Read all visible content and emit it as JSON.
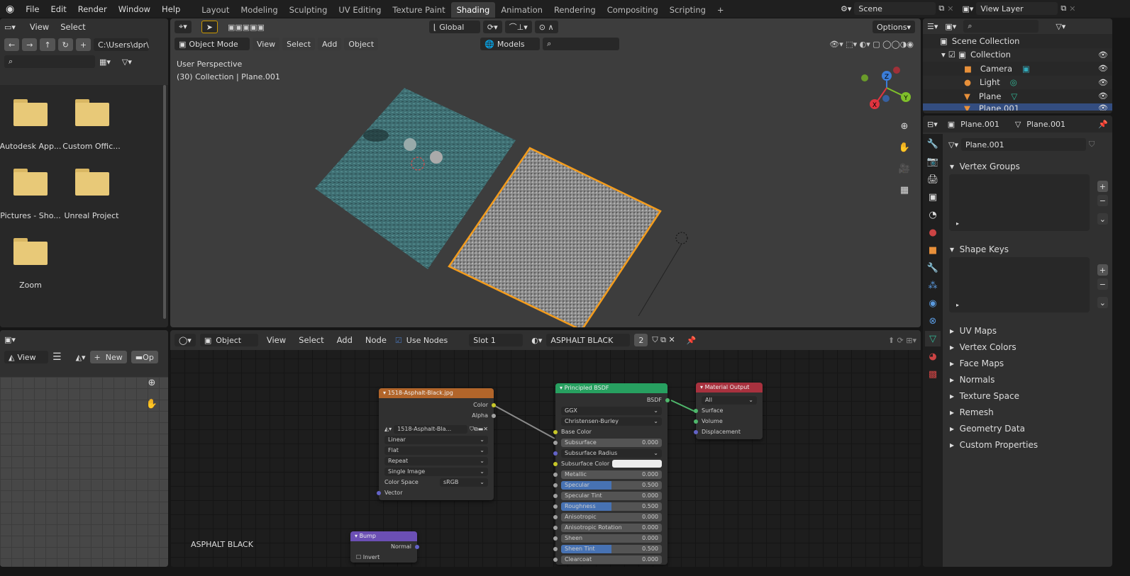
{
  "topbar": {
    "menus": [
      "File",
      "Edit",
      "Render",
      "Window",
      "Help"
    ],
    "tabs": [
      "Layout",
      "Modeling",
      "Sculpting",
      "UV Editing",
      "Texture Paint",
      "Shading",
      "Animation",
      "Rendering",
      "Compositing",
      "Scripting"
    ],
    "active_tab": "Shading",
    "scene": "Scene",
    "view_layer": "View Layer"
  },
  "file_browser": {
    "menus": [
      "View",
      "Select"
    ],
    "path": "C:\\Users\\dpr\\...",
    "items": [
      "Autodesk App...",
      "Custom Offic...",
      "Pictures - Sho...",
      "Unreal Project",
      "Zoom"
    ]
  },
  "viewport": {
    "mode": "Object Mode",
    "menus": [
      "View",
      "Select",
      "Add",
      "Object"
    ],
    "orientation": "Global",
    "models": "Models",
    "options": "Options",
    "perspective": "User Perspective",
    "info": "(30) Collection | Plane.001",
    "axes": [
      "X",
      "Y",
      "Z"
    ]
  },
  "outliner": {
    "root": "Scene Collection",
    "collection": "Collection",
    "items": [
      "Camera",
      "Light",
      "Plane",
      "Plane.001"
    ]
  },
  "properties": {
    "object": "Plane.001",
    "data": "Plane.001",
    "mesh_name": "Plane.001",
    "sections": [
      "Vertex Groups",
      "Shape Keys",
      "UV Maps",
      "Vertex Colors",
      "Face Maps",
      "Normals",
      "Texture Space",
      "Remesh",
      "Geometry Data",
      "Custom Properties"
    ]
  },
  "image_editor": {
    "view": "View",
    "new": "New",
    "open": "Op"
  },
  "node_editor": {
    "object": "Object",
    "menus": [
      "View",
      "Select",
      "Add",
      "Node"
    ],
    "use_nodes": "Use Nodes",
    "slot": "Slot 1",
    "material": "ASPHALT BLACK",
    "users": "2",
    "frame_label": "ASPHALT BLACK",
    "image_node": {
      "title": "1518-Asphalt-Black.jpg",
      "outputs": [
        "Color",
        "Alpha"
      ],
      "image": "1518-Asphalt-Bla...",
      "interpolation": "Linear",
      "projection": "Flat",
      "extension": "Repeat",
      "source": "Single Image",
      "color_space_label": "Color Space",
      "color_space": "sRGB",
      "input": "Vector"
    },
    "bsdf": {
      "title": "Principled BSDF",
      "output": "BSDF",
      "distribution": "GGX",
      "subsurface_method": "Christensen-Burley",
      "base_color": "Base Color",
      "fields": [
        {
          "label": "Subsurface",
          "value": "0.000",
          "fill": 0
        },
        {
          "label": "Subsurface Radius",
          "value": "",
          "fill": 0
        },
        {
          "label": "Subsurface Color",
          "value": "",
          "fill": 0
        },
        {
          "label": "Metallic",
          "value": "0.000",
          "fill": 0
        },
        {
          "label": "Specular",
          "value": "0.500",
          "fill": 0.5
        },
        {
          "label": "Specular Tint",
          "value": "0.000",
          "fill": 0
        },
        {
          "label": "Roughness",
          "value": "0.500",
          "fill": 0.5
        },
        {
          "label": "Anisotropic",
          "value": "0.000",
          "fill": 0
        },
        {
          "label": "Anisotropic Rotation",
          "value": "0.000",
          "fill": 0
        },
        {
          "label": "Sheen",
          "value": "0.000",
          "fill": 0
        },
        {
          "label": "Sheen Tint",
          "value": "0.500",
          "fill": 0.5
        },
        {
          "label": "Clearcoat",
          "value": "0.000",
          "fill": 0
        }
      ]
    },
    "output": {
      "title": "Material Output",
      "target": "All",
      "inputs": [
        "Surface",
        "Volume",
        "Displacement"
      ]
    },
    "bump": {
      "title": "Bump",
      "output": "Normal",
      "invert": "Invert"
    }
  },
  "colors": {
    "accent": "#4772b3",
    "image_node": "#b2652a",
    "shader_node": "#27a060",
    "output_node": "#a8313e",
    "vector_node": "#6b4fb4",
    "selection": "#f39c1d"
  }
}
